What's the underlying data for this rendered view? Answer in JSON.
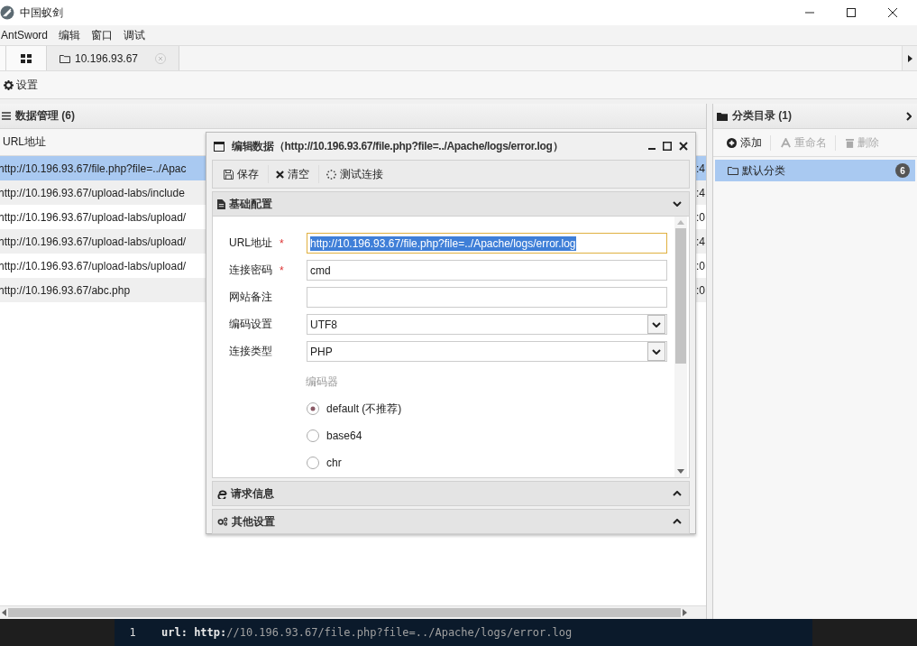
{
  "window": {
    "title": "中国蚁剑"
  },
  "menu": [
    "AntSword",
    "编辑",
    "窗口",
    "调试"
  ],
  "tabs": [
    {
      "kind": "grid",
      "selected": true
    },
    {
      "kind": "folder",
      "label": "10.196.93.67",
      "selected": false
    }
  ],
  "toolbar": {
    "settings": "设置"
  },
  "data_panel": {
    "title": "数据管理 (6)",
    "columns": [
      "URL地址"
    ],
    "rows": [
      {
        "url": "http://10.196.93.67/file.php?file=../Apac",
        "column_2": ":4",
        "selected": true
      },
      {
        "url": "http://10.196.93.67/upload-labs/include",
        "column_2": ":4",
        "selected": false
      },
      {
        "url": "http://10.196.93.67/upload-labs/upload/",
        "column_2": ":0",
        "selected": false
      },
      {
        "url": "http://10.196.93.67/upload-labs/upload/",
        "column_2": ":4",
        "selected": false
      },
      {
        "url": "http://10.196.93.67/upload-labs/upload/",
        "column_2": ":0",
        "selected": false
      },
      {
        "url": "http://10.196.93.67/abc.php",
        "column_2": ":0",
        "selected": false
      }
    ]
  },
  "category_panel": {
    "title": "分类目录 (1)",
    "actions": [
      {
        "kind": "add",
        "label": "添加",
        "disabled": false
      },
      {
        "kind": "rename",
        "label": "重命名",
        "disabled": true
      },
      {
        "kind": "delete",
        "label": "删除",
        "disabled": true
      }
    ],
    "items": [
      {
        "label": "默认分类",
        "count": "6",
        "selected": true
      }
    ]
  },
  "dialog": {
    "title": "编辑数据（http://10.196.93.67/file.php?file=../Apache/logs/error.log）",
    "toolbar": [
      {
        "kind": "save",
        "label": "保存"
      },
      {
        "kind": "clear",
        "label": "清空"
      },
      {
        "kind": "test",
        "label": "测试连接"
      }
    ],
    "sections": [
      {
        "kind": "file",
        "title": "基础配置",
        "expanded": true
      },
      {
        "kind": "ie",
        "title": "请求信息",
        "expanded": false
      },
      {
        "kind": "gears",
        "title": "其他设置",
        "expanded": false
      }
    ],
    "fields": [
      {
        "kind": "text",
        "label": "URL地址",
        "required_mark": "*",
        "value": "http://10.196.93.67/file.php?file=../Apache/logs/error.log",
        "focused": true
      },
      {
        "kind": "text",
        "label": "连接密码",
        "required_mark": "*",
        "value": "cmd",
        "focused": false
      },
      {
        "kind": "text",
        "label": "网站备注",
        "focused": false
      },
      {
        "kind": "select",
        "label": "编码设置",
        "value": "UTF8"
      },
      {
        "kind": "select",
        "label": "连接类型",
        "value": "PHP"
      }
    ],
    "encoder": {
      "label": "编码器",
      "options": [
        {
          "label": "default (不推荐)",
          "selected": true
        },
        {
          "label": "base64",
          "selected": false
        },
        {
          "label": "chr",
          "selected": false
        }
      ]
    }
  },
  "console": {
    "line_number": "1",
    "key": "url:",
    "scheme": "http:",
    "rest": "//10.196.93.67/file.php?file=../Apache/logs/error.log"
  }
}
